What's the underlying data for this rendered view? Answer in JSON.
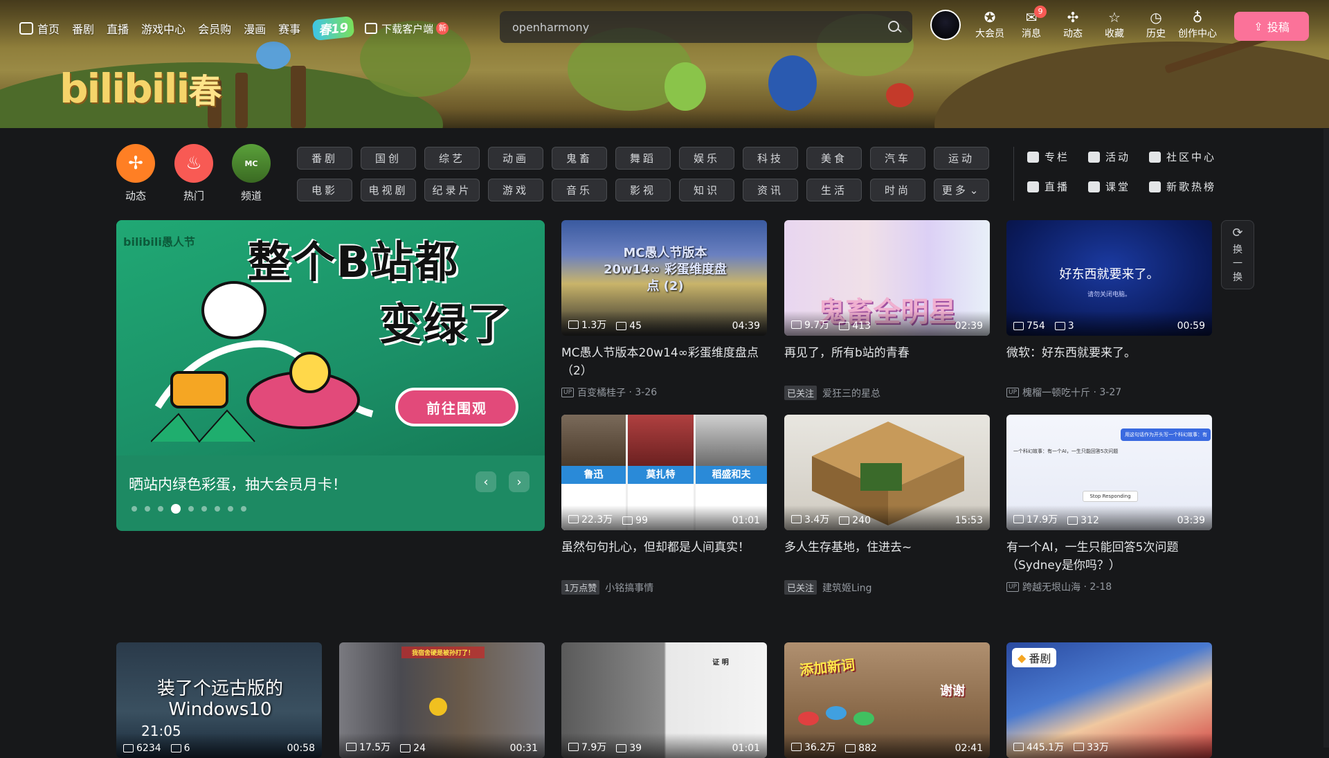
{
  "header": {
    "nav": [
      {
        "label": "首页",
        "icon": "tv-icon"
      },
      {
        "label": "番剧"
      },
      {
        "label": "直播"
      },
      {
        "label": "游戏中心"
      },
      {
        "label": "会员购"
      },
      {
        "label": "漫画"
      },
      {
        "label": "赛事"
      }
    ],
    "spring_badge": "春19",
    "download_label": "下载客户端",
    "new_badge": "新",
    "search_value": "openharmony",
    "right": [
      {
        "label": "大会员",
        "icon": "vip-icon"
      },
      {
        "label": "消息",
        "icon": "message-icon",
        "badge": "9"
      },
      {
        "label": "动态",
        "icon": "dynamic-icon"
      },
      {
        "label": "收藏",
        "icon": "star-icon"
      },
      {
        "label": "历史",
        "icon": "clock-icon"
      },
      {
        "label": "创作中心",
        "icon": "bulb-icon"
      }
    ],
    "upload_label": "投稿"
  },
  "logo": {
    "text": "bilibili",
    "suffix": "春"
  },
  "quick": [
    {
      "label": "动态",
      "color": "#ff7f24"
    },
    {
      "label": "热门",
      "color": "#f85a54"
    },
    {
      "label": "频道",
      "color": "#3d7a2a"
    }
  ],
  "tags": [
    "番剧",
    "国创",
    "综艺",
    "动画",
    "鬼畜",
    "舞蹈",
    "娱乐",
    "科技",
    "美食",
    "汽车",
    "运动",
    "电影",
    "电视剧",
    "纪录片",
    "游戏",
    "音乐",
    "影视",
    "知识",
    "资讯",
    "生活",
    "时尚",
    "更多"
  ],
  "links": [
    "专栏",
    "活动",
    "社区中心",
    "直播",
    "课堂",
    "新歌热榜"
  ],
  "carousel": {
    "brand": "bilibili愚人节",
    "headline1": "整个B站都",
    "headline2": "变绿了",
    "button": "前往围观",
    "caption": "晒站内绿色彩蛋，抽大会员月卡！",
    "active_dot": 3,
    "dot_count": 9
  },
  "refresh": {
    "label1": "换",
    "label2": "一",
    "label3": "换"
  },
  "cards": [
    {
      "title": "MC愚人节版本20w14∞彩蛋维度盘点（2）",
      "views": "1.3万",
      "danmaku": "45",
      "duration": "04:39",
      "author": "百变橘桂子",
      "date": "3-26",
      "badge": "up",
      "overlay": "MC愚人节版本 20w14∞ 彩蛋维度盘点 (2)"
    },
    {
      "title": "再见了，所有b站的青春",
      "views": "9.7万",
      "danmaku": "413",
      "duration": "02:39",
      "author": "爱狂三的星总",
      "date": "",
      "badge": "已关注",
      "overlay": "鬼畜全明星"
    },
    {
      "title": "微软：好东西就要来了。",
      "views": "754",
      "danmaku": "3",
      "duration": "00:59",
      "author": "槐榴一顿吃十斤",
      "date": "3-27",
      "badge": "up",
      "overlay": "好东西就要来了。",
      "overlay_sub": "请勿关闭电脑。"
    },
    {
      "title": "虽然句句扎心，但却都是人间真实！",
      "views": "22.3万",
      "danmaku": "99",
      "duration": "01:01",
      "author": "小铭搞事情",
      "date": "",
      "badge": "1万点赞",
      "names": [
        "鲁迅",
        "莫扎特",
        "稻盛和夫"
      ]
    },
    {
      "title": "多人生存基地，住进去~",
      "views": "3.4万",
      "danmaku": "240",
      "duration": "15:53",
      "author": "建筑姬Ling",
      "date": "",
      "badge": "已关注"
    },
    {
      "title": "有一个AI，一生只能回答5次问题（Sydney是你吗？）",
      "views": "17.9万",
      "danmaku": "312",
      "duration": "03:39",
      "author": "跨越无垠山海",
      "date": "2-18",
      "badge": "up",
      "chat_bubble": "用这句话作为开头写一个科幻故事：有",
      "chat_line": "一个科幻故事：有一个AI，一生只能回答5次问题",
      "chat_button": "Stop Responding"
    },
    {
      "overlay": "装了个远古版的 Windows10",
      "time": "21:05",
      "views": "6234",
      "danmaku": "6",
      "duration": "00:58"
    },
    {
      "views": "17.5万",
      "danmaku": "24",
      "duration": "00:31",
      "overlay": "我宿舍硬是被孙打了！"
    },
    {
      "views": "7.9万",
      "danmaku": "39",
      "duration": "01:01",
      "overlay": "证 明"
    },
    {
      "views": "36.2万",
      "danmaku": "882",
      "duration": "02:41",
      "overlay": "添加新词",
      "overlay2": "谢谢"
    },
    {
      "views": "445.1万",
      "danmaku": "33万",
      "duration": "",
      "badge": "番剧"
    }
  ],
  "colors": {
    "accent": "#fb7299",
    "bg": "#17181a"
  }
}
